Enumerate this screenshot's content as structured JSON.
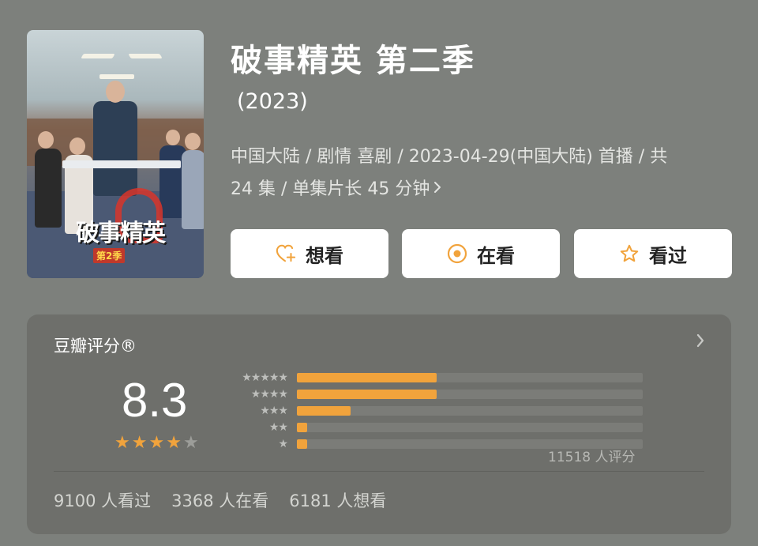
{
  "show": {
    "title": "破事精英 第二季",
    "year": "(2023)",
    "meta_line1": "中国大陆 / 剧情 喜剧 / 2023-04-29(中国大陆) 首播 / 共",
    "meta_line2": "24 集 / 单集片长 45 分钟",
    "poster_logo": "破事精英",
    "poster_sub": "第2季"
  },
  "actions": {
    "want": "想看",
    "watching": "在看",
    "watched": "看过"
  },
  "rating": {
    "heading": "豆瓣评分®",
    "score": "8.3",
    "stars_filled": 4,
    "stars_total": 5,
    "distribution_percent": [
      40.4,
      40.4,
      15.5,
      2.9,
      2.9
    ],
    "total": "11518 人评分",
    "watched": "9100 人看过",
    "watching": "3368 人在看",
    "want": "6181 人想看"
  },
  "colors": {
    "accent": "#f1a33c",
    "background": "#7d807c",
    "panel": "#6e6f6b"
  },
  "icons": {
    "want": "heart-plus-icon",
    "watching": "target-icon",
    "watched": "star-outline-icon",
    "more": "chevron-right-icon"
  }
}
